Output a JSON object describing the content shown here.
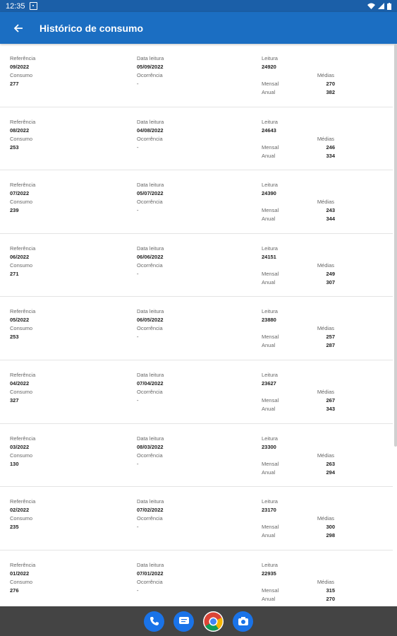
{
  "status": {
    "time": "12:35"
  },
  "appbar": {
    "title": "Histórico de consumo"
  },
  "labels": {
    "referencia": "Referência",
    "data_leitura": "Data leitura",
    "leitura": "Leitura",
    "consumo": "Consumo",
    "ocorrencia": "Ocorrência",
    "medias": "Médias",
    "mensal": "Mensal",
    "anual": "Anual"
  },
  "records": [
    {
      "referencia": "09/2022",
      "data_leitura": "05/09/2022",
      "leitura": "24920",
      "consumo": "277",
      "ocorrencia": "-",
      "mensal": "270",
      "anual": "382"
    },
    {
      "referencia": "08/2022",
      "data_leitura": "04/08/2022",
      "leitura": "24643",
      "consumo": "253",
      "ocorrencia": "-",
      "mensal": "246",
      "anual": "334"
    },
    {
      "referencia": "07/2022",
      "data_leitura": "05/07/2022",
      "leitura": "24390",
      "consumo": "239",
      "ocorrencia": "-",
      "mensal": "243",
      "anual": "344"
    },
    {
      "referencia": "06/2022",
      "data_leitura": "06/06/2022",
      "leitura": "24151",
      "consumo": "271",
      "ocorrencia": "-",
      "mensal": "249",
      "anual": "307"
    },
    {
      "referencia": "05/2022",
      "data_leitura": "06/05/2022",
      "leitura": "23880",
      "consumo": "253",
      "ocorrencia": "-",
      "mensal": "257",
      "anual": "287"
    },
    {
      "referencia": "04/2022",
      "data_leitura": "07/04/2022",
      "leitura": "23627",
      "consumo": "327",
      "ocorrencia": "-",
      "mensal": "267",
      "anual": "343"
    },
    {
      "referencia": "03/2022",
      "data_leitura": "08/03/2022",
      "leitura": "23300",
      "consumo": "130",
      "ocorrencia": "-",
      "mensal": "263",
      "anual": "294"
    },
    {
      "referencia": "02/2022",
      "data_leitura": "07/02/2022",
      "leitura": "23170",
      "consumo": "235",
      "ocorrencia": "-",
      "mensal": "300",
      "anual": "298"
    },
    {
      "referencia": "01/2022",
      "data_leitura": "07/01/2022",
      "leitura": "22935",
      "consumo": "276",
      "ocorrencia": "-",
      "mensal": "315",
      "anual": "270"
    }
  ],
  "navbar": {
    "icons": [
      "phone-icon",
      "messages-icon",
      "chrome-icon",
      "camera-icon"
    ]
  },
  "colors": {
    "appbar": "#1b6ec2",
    "statusbar": "#1b5fa8",
    "navbar": "#444444"
  }
}
